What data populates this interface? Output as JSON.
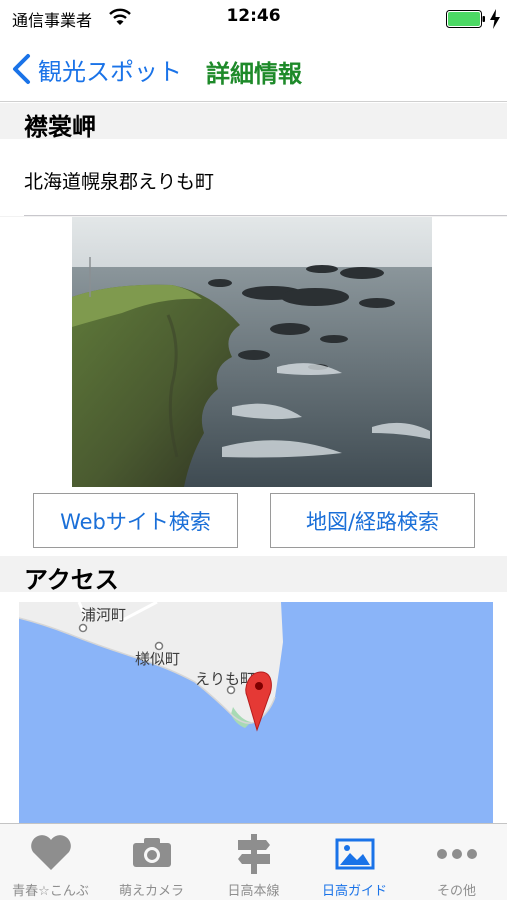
{
  "status_bar": {
    "carrier": "通信事業者",
    "time": "12:46",
    "battery_color": "#4cd964"
  },
  "nav": {
    "back_label": "観光スポット",
    "title": "詳細情報",
    "accent_color": "#1a73e8",
    "title_color": "#1e8a2a"
  },
  "spot": {
    "name": "襟裳岬",
    "address": "北海道幌泉郡えりも町",
    "photo_icon": "coastal-cliff-photo"
  },
  "actions": {
    "web_search": "Webサイト検索",
    "route_search": "地図/経路検索"
  },
  "access": {
    "header": "アクセス",
    "map_labels": {
      "urakawa": "浦河町",
      "samani": "様似町",
      "erimo": "えりも町"
    },
    "pin_icon": "map-pin-icon"
  },
  "tabs": [
    {
      "label": "青春☆こんぶ",
      "icon": "heart-icon",
      "active": false
    },
    {
      "label": "萌えカメラ",
      "icon": "camera-icon",
      "active": false
    },
    {
      "label": "日高本線",
      "icon": "signpost-icon",
      "active": false
    },
    {
      "label": "日高ガイド",
      "icon": "picture-icon",
      "active": true
    },
    {
      "label": "その他",
      "icon": "more-icon",
      "active": false
    }
  ]
}
